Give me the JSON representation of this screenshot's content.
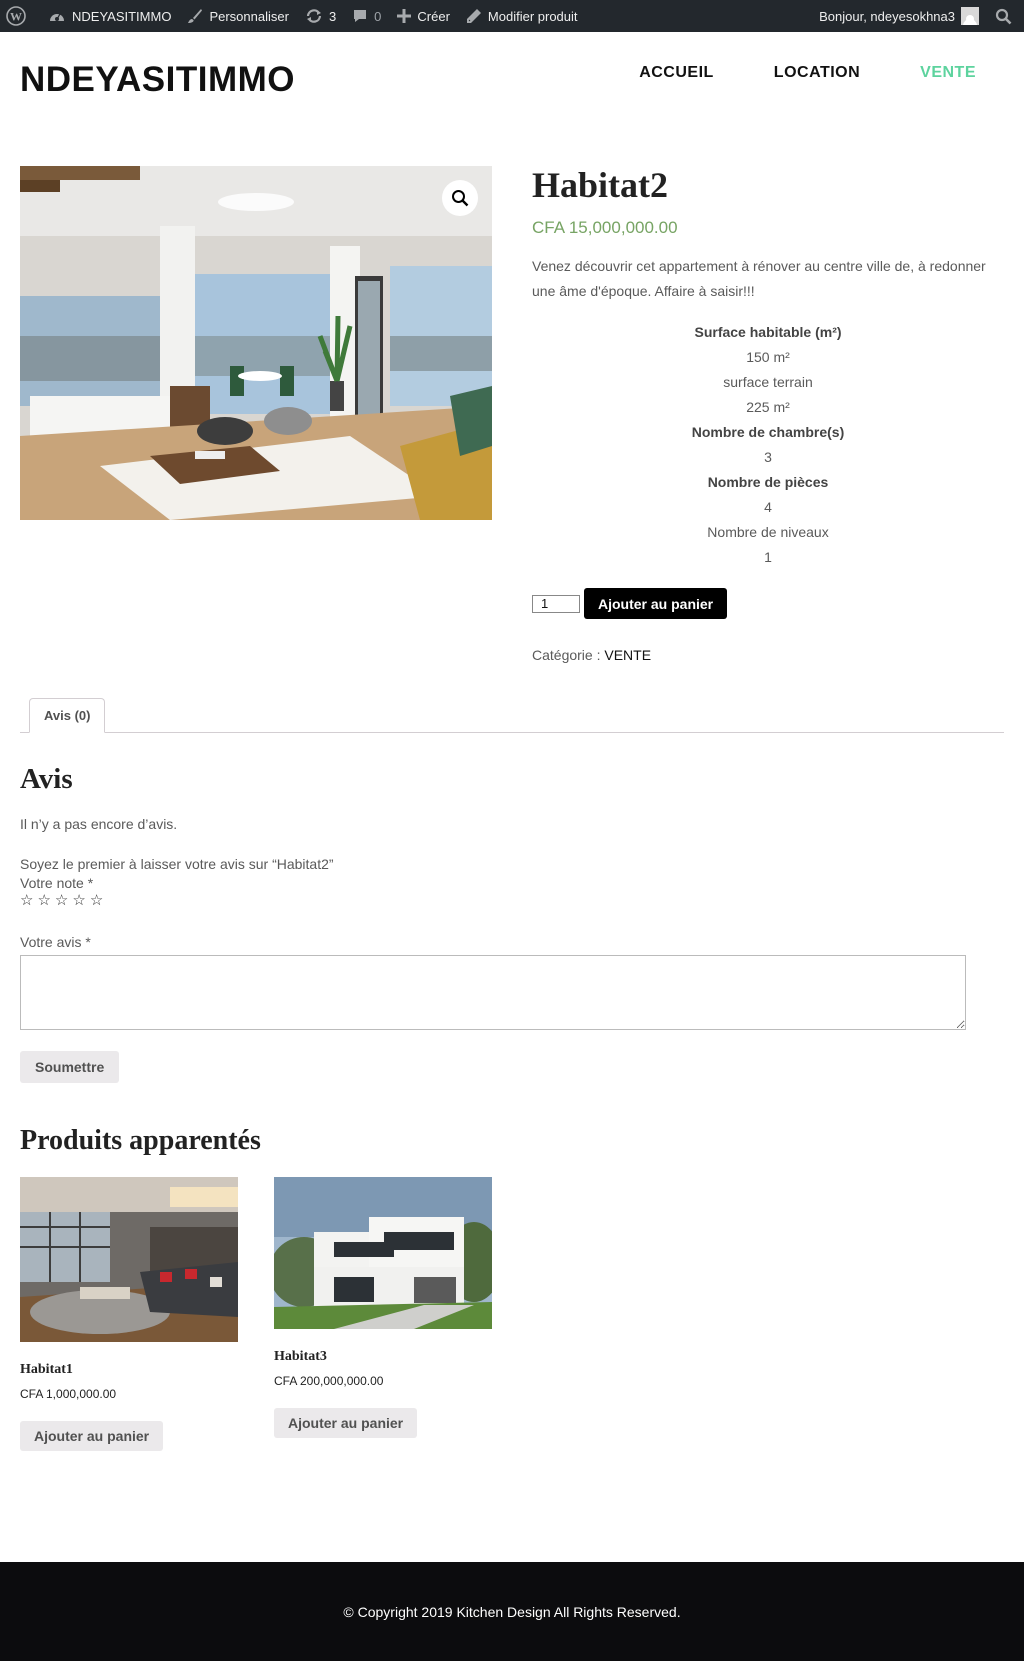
{
  "adminbar": {
    "site_name": "NDEYASITIMMO",
    "customize": "Personnaliser",
    "updates_count": "3",
    "comments_count": "0",
    "new": "Créer",
    "edit_product": "Modifier produit",
    "greeting": "Bonjour, ndeyesokhna3"
  },
  "site": {
    "title": "NDEYASITIMMO"
  },
  "nav": {
    "items": [
      {
        "label": "ACCUEIL",
        "active": false
      },
      {
        "label": "LOCATION",
        "active": false
      },
      {
        "label": "VENTE",
        "active": true
      }
    ],
    "active_color": "#5dd39e"
  },
  "product": {
    "title": "Habitat2",
    "price": "CFA 15,000,000.00",
    "short_description": "Venez découvrir cet appartement à rénover au centre ville de, à redonner une âme d'époque. Affaire à saisir!!!",
    "specs": [
      {
        "text": "Surface habitable (m²)",
        "bold": true
      },
      {
        "text": "150 m²",
        "bold": false
      },
      {
        "text": "surface terrain",
        "bold": false
      },
      {
        "text": "225 m²",
        "bold": false
      },
      {
        "text": "Nombre de chambre(s)",
        "bold": true
      },
      {
        "text": "3",
        "bold": false
      },
      {
        "text": "Nombre de pièces",
        "bold": true
      },
      {
        "text": "4",
        "bold": false
      },
      {
        "text": "Nombre de niveaux",
        "bold": false
      },
      {
        "text": "1",
        "bold": false
      }
    ],
    "quantity": "1",
    "add_to_cart": "Ajouter au panier",
    "category_label": "Catégorie :",
    "category_value": "VENTE",
    "price_color": "#77a464"
  },
  "tabs": {
    "reviews_tab": "Avis (0)"
  },
  "reviews": {
    "title": "Avis",
    "empty": "Il n’y a pas encore d’avis.",
    "intro": "Soyez le premier à laisser votre avis sur “Habitat2”",
    "rating_label": "Votre note *",
    "stars": [
      "☆",
      "☆",
      "☆",
      "☆",
      "☆"
    ],
    "comment_label": "Votre avis *",
    "submit": "Soumettre"
  },
  "related": {
    "title": "Produits apparentés",
    "items": [
      {
        "name": "Habitat1",
        "price": "CFA 1,000,000.00",
        "button": "Ajouter au panier"
      },
      {
        "name": "Habitat3",
        "price": "CFA 200,000,000.00",
        "button": "Ajouter au panier"
      }
    ]
  },
  "footer": {
    "text": "© Copyright 2019 Kitchen Design All Rights Reserved."
  }
}
